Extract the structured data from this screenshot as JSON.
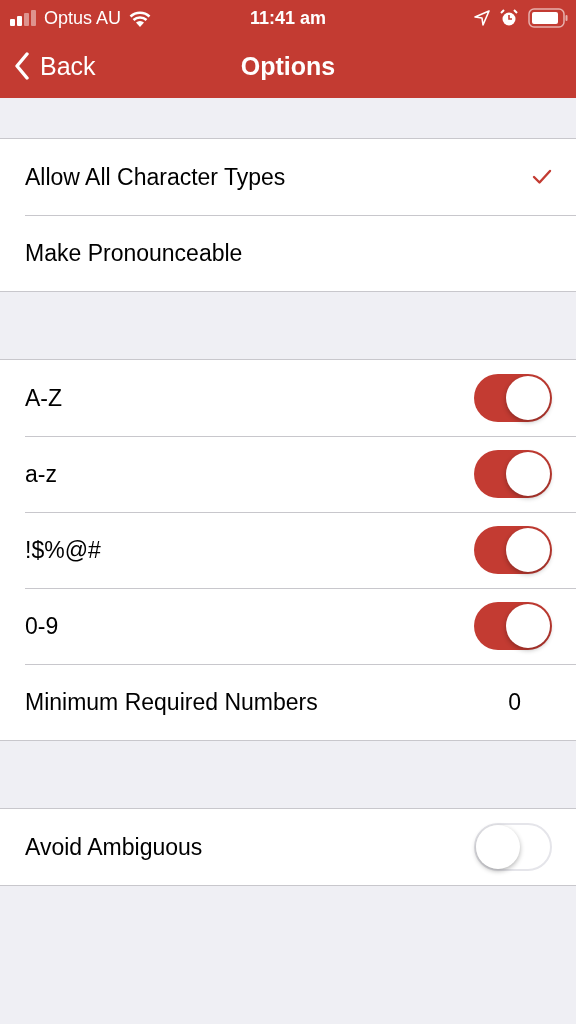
{
  "status_bar": {
    "carrier": "Optus AU",
    "time": "11:41 am"
  },
  "nav": {
    "back": "Back",
    "title": "Options"
  },
  "sections": [
    {
      "rows": [
        {
          "kind": "check",
          "label": "Allow All Character Types",
          "checked": true
        },
        {
          "kind": "check",
          "label": "Make Pronounceable",
          "checked": false
        }
      ]
    },
    {
      "rows": [
        {
          "kind": "toggle",
          "label": "A-Z",
          "on": true
        },
        {
          "kind": "toggle",
          "label": "a-z",
          "on": true
        },
        {
          "kind": "toggle",
          "label": "!$%@#",
          "on": true
        },
        {
          "kind": "toggle",
          "label": "0-9",
          "on": true
        },
        {
          "kind": "value",
          "label": "Minimum Required Numbers",
          "value": "0"
        }
      ]
    },
    {
      "rows": [
        {
          "kind": "toggle",
          "label": "Avoid Ambiguous",
          "on": false
        }
      ]
    }
  ]
}
